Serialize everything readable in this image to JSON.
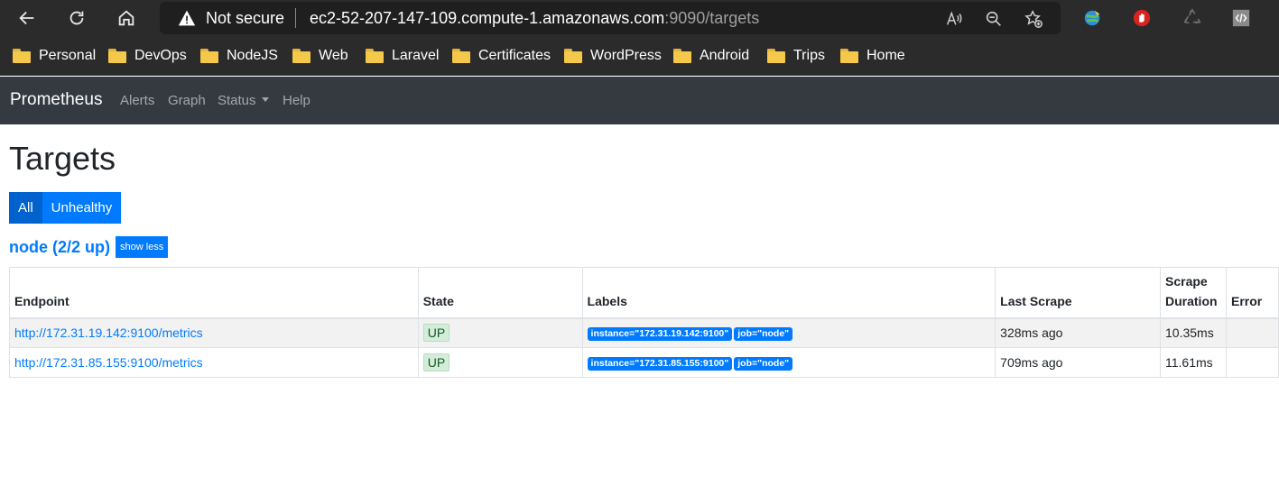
{
  "browser": {
    "security_label": "Not secure",
    "url_host": "ec2-52-207-147-109.compute-1.amazonaws.com",
    "url_rest": ":9090/targets"
  },
  "bookmarks": [
    {
      "label": "Personal"
    },
    {
      "label": "DevOps"
    },
    {
      "label": "NodeJS"
    },
    {
      "label": "Web"
    },
    {
      "label": "Laravel"
    },
    {
      "label": "Certificates"
    },
    {
      "label": "WordPress"
    },
    {
      "label": "Android"
    },
    {
      "label": "Trips"
    },
    {
      "label": "Home"
    }
  ],
  "navbar": {
    "brand": "Prometheus",
    "links": [
      "Alerts",
      "Graph",
      "Status",
      "Help"
    ]
  },
  "page": {
    "title": "Targets",
    "filter_all": "All",
    "filter_unhealthy": "Unhealthy",
    "job_title": "node (2/2 up)",
    "show_less": "show less"
  },
  "table": {
    "headers": [
      "Endpoint",
      "State",
      "Labels",
      "Last Scrape",
      "Scrape Duration",
      "Error"
    ],
    "rows": [
      {
        "endpoint": "http://172.31.19.142:9100/metrics",
        "state": "UP",
        "labels": [
          "instance=\"172.31.19.142:9100\"",
          "job=\"node\""
        ],
        "last_scrape": "328ms ago",
        "duration": "10.35ms",
        "error": ""
      },
      {
        "endpoint": "http://172.31.85.155:9100/metrics",
        "state": "UP",
        "labels": [
          "instance=\"172.31.85.155:9100\"",
          "job=\"node\""
        ],
        "last_scrape": "709ms ago",
        "duration": "11.61ms",
        "error": ""
      }
    ]
  },
  "colors": {
    "primary": "#007bff",
    "primary_active": "#0062cc",
    "navbar_bg": "#343a40",
    "browser_bg": "#2b2b2b",
    "state_up_bg": "#d4edda"
  }
}
